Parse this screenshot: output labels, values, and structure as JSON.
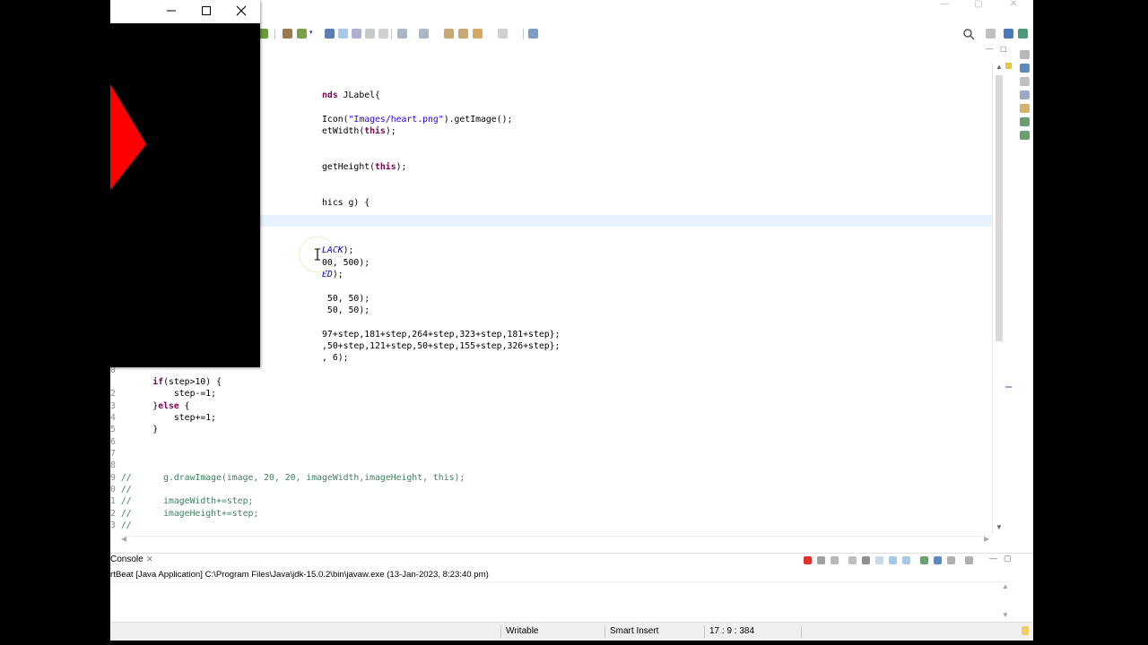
{
  "editor": {
    "lines": [
      {
        "ln": "",
        "html": ""
      },
      {
        "ln": "",
        "html": ""
      },
      {
        "ln": "",
        "html": ""
      },
      {
        "ln": "",
        "html": "                                       <span class=\"kw\">nds</span> JLabel{"
      },
      {
        "ln": "",
        "html": ""
      },
      {
        "ln": "",
        "html": "                                       Icon(<span class=\"str\">\"Images/heart.png\"</span>).getImage();"
      },
      {
        "ln": "",
        "html": "                                       etWidth(<span class=\"kw\">this</span>);"
      },
      {
        "ln": "",
        "html": ""
      },
      {
        "ln": "",
        "html": ""
      },
      {
        "ln": "",
        "html": "                                       getHeight(<span class=\"kw\">this</span>);"
      },
      {
        "ln": "",
        "html": ""
      },
      {
        "ln": "",
        "html": ""
      },
      {
        "ln": "",
        "html": "                                       hics g) {"
      },
      {
        "ln": "",
        "html": ""
      },
      {
        "ln": "",
        "html": ""
      },
      {
        "ln": "",
        "html": ""
      },
      {
        "ln": "",
        "html": "                                       <span class=\"fld\">LACK</span>);"
      },
      {
        "ln": "",
        "html": "                                       00, 500);"
      },
      {
        "ln": "",
        "html": "                                       <span class=\"fld\">ED</span>);"
      },
      {
        "ln": "",
        "html": ""
      },
      {
        "ln": "",
        "html": "                                        50, 50);"
      },
      {
        "ln": "",
        "html": "                                        50, 50);"
      },
      {
        "ln": "",
        "html": ""
      },
      {
        "ln": "",
        "html": "                                       97+step,181+step,264+step,323+step,181+step};"
      },
      {
        "ln": "",
        "html": "                                       ,50+step,121+step,50+step,155+step,326+step};"
      },
      {
        "ln": "",
        "html": "                                       , 6);"
      },
      {
        "ln": "0",
        "html": ""
      },
      {
        "ln": "",
        "html": "       <span class=\"kw\">if</span>(step>10) {"
      },
      {
        "ln": "2",
        "html": "           step-=1;"
      },
      {
        "ln": "3",
        "html": "       }<span class=\"kw\">else</span> {"
      },
      {
        "ln": "4",
        "html": "           step+=1;"
      },
      {
        "ln": "5",
        "html": "       }"
      },
      {
        "ln": "6",
        "html": ""
      },
      {
        "ln": "7",
        "html": ""
      },
      {
        "ln": "8",
        "html": ""
      },
      {
        "ln": "9",
        "html": " <span class=\"cm\">//      g.drawImage(image, 20, 20, imageWidth,imageHeight, this);</span>"
      },
      {
        "ln": "0",
        "html": " <span class=\"cm\">//</span>"
      },
      {
        "ln": "1",
        "html": " <span class=\"cm\">//      imageWidth+=step;</span>"
      },
      {
        "ln": "2",
        "html": " <span class=\"cm\">//      imageHeight+=step;</span>"
      },
      {
        "ln": "3",
        "html": " <span class=\"cm\">//</span>"
      }
    ]
  },
  "console": {
    "tab_label": "Console",
    "close_glyph": "✕",
    "launch_info": "rtBeat [Java Application] C:\\Program Files\\Java\\jdk-15.0.2\\bin\\javaw.exe  (13-Jan-2023, 8:23:40 pm)"
  },
  "statusbar": {
    "writable": "Writable",
    "insert_mode": "Smart Insert",
    "position": "17 : 9 : 384"
  },
  "app_window": {
    "minimize_glyph": "—",
    "close_glyph": "✕",
    "shape_color": "#ff0000"
  },
  "colors": {
    "keyword": "#7f0055",
    "string": "#2a00ff",
    "comment": "#3f7f5f",
    "field": "#0000c0",
    "current_line": "#e8f2fe"
  }
}
